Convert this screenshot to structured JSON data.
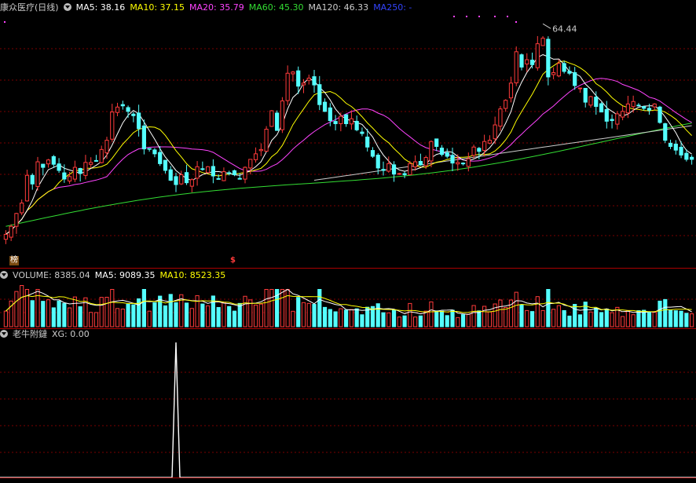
{
  "header": {
    "title": "康众医疗(日线)",
    "ma5": "MA5: 38.16",
    "ma10": "MA10: 37.15",
    "ma20": "MA20: 35.79",
    "ma60": "MA60: 45.30",
    "ma120": "MA120: 46.33",
    "ma250": "MA250: -"
  },
  "volume_header": {
    "label": "VOLUME: 8385.04",
    "ma5": "MA5: 9089.35",
    "ma10": "MA10: 8523.35"
  },
  "indicator_header": {
    "name": "老牛附鐽",
    "xg": "XG: 0.00"
  },
  "markers": {
    "bang": "榜",
    "dollar": "$",
    "peak_label": "64.44"
  },
  "colors": {
    "up": "#ff3b3b",
    "down": "#54ffff",
    "ma5": "#ffffff",
    "ma10": "#ffff00",
    "ma20": "#ff44ff",
    "ma60": "#33dd33",
    "ma120": "#cccccc",
    "ma250": "#3344ff",
    "grid": "#7a0000"
  },
  "chart_data": [
    {
      "type": "candlestick",
      "title": "康众医疗(日线)",
      "ylim": [
        30,
        65.5
      ],
      "peak_high": 64.44,
      "series_close": [
        30.2,
        31.5,
        33.6,
        35.3,
        39.8,
        38.4,
        42.0,
        41.1,
        42.3,
        41.6,
        40.6,
        39.2,
        39.6,
        41.1,
        40.1,
        41.9,
        41.9,
        42.2,
        44.0,
        45.5,
        50.1,
        50.9,
        51.1,
        50.2,
        49.5,
        47.4,
        44.1,
        44.1,
        43.3,
        41.7,
        40.6,
        39.0,
        38.3,
        39.9,
        38.6,
        39.1,
        41.2,
        40.8,
        41.2,
        39.7,
        39.2,
        40.4,
        40.2,
        39.9,
        39.3,
        41.1,
        42.4,
        43.3,
        44.0,
        47.3,
        50.3,
        47.1,
        51.9,
        56.4,
        56.6,
        54.3,
        54.8,
        55.6,
        54.5,
        51.3,
        50.2,
        48.7,
        48.2,
        49.4,
        48.2,
        49.0,
        47.2,
        46.6,
        44.4,
        42.9,
        41.0,
        40.6,
        41.7,
        40.0,
        40.1,
        39.9,
        41.7,
        42.0,
        41.5,
        42.7,
        45.3,
        44.5,
        43.2,
        42.9,
        41.8,
        41.9,
        41.7,
        42.5,
        44.4,
        43.7,
        45.3,
        45.5,
        48.0,
        50.6,
        52.0,
        54.8,
        59.9,
        57.4,
        58.6,
        57.8,
        61.2,
        62.1,
        55.8,
        56.5,
        58.0,
        56.7,
        56.4,
        54.4,
        54.0,
        51.7,
        52.6,
        51.0,
        50.1,
        48.6,
        48.7,
        49.8,
        50.2,
        51.4,
        51.8,
        51.2,
        50.7,
        50.4,
        51.4,
        48.4,
        45.5,
        44.5,
        43.9,
        43.1,
        42.4,
        42.4
      ]
    },
    {
      "type": "bar",
      "title": "VOLUME",
      "ylim": [
        0,
        24000
      ]
    },
    {
      "type": "line",
      "title": "老牛附鐽",
      "ylim": [
        0,
        1
      ],
      "spike_index": 32,
      "spike_value": 1
    }
  ]
}
